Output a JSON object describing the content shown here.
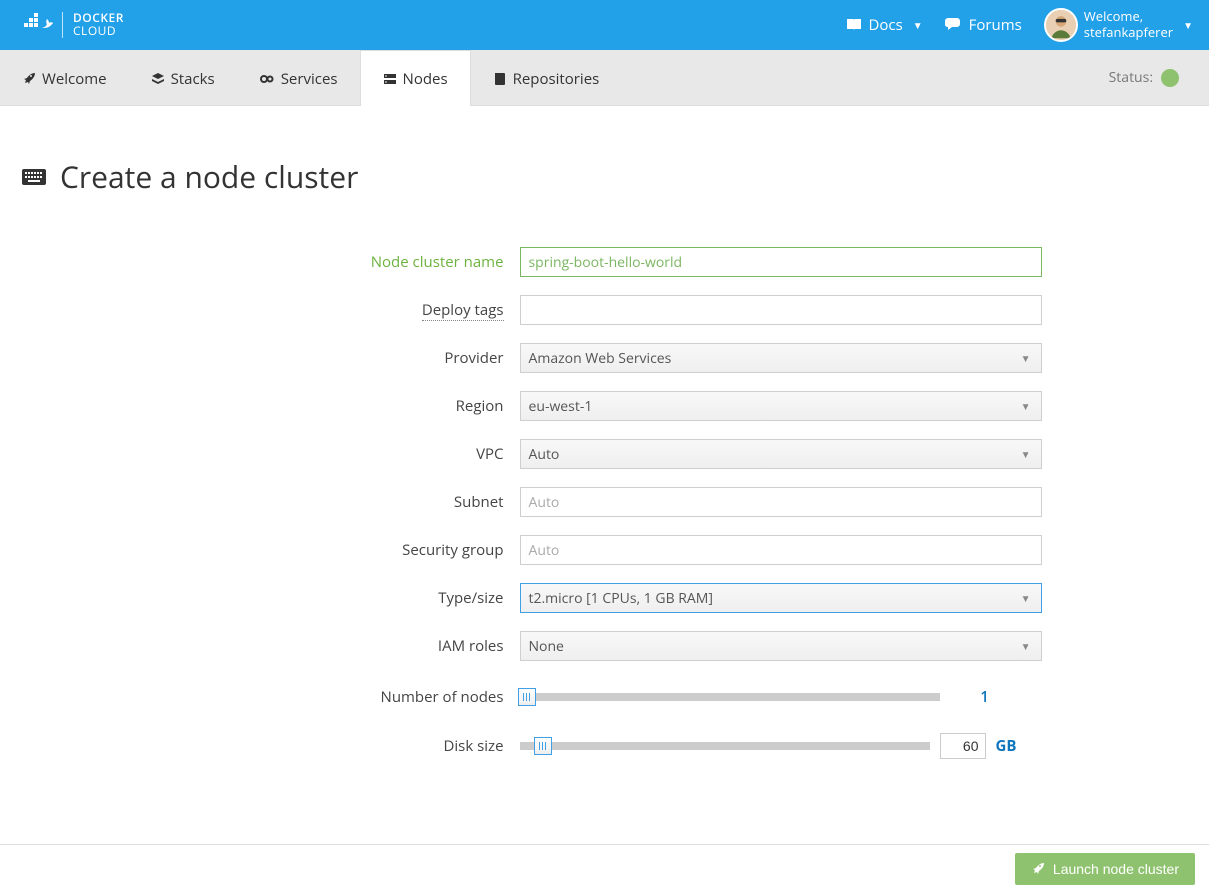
{
  "header": {
    "brand_line1": "DOCKER",
    "brand_line2": "CLOUD",
    "docs_label": "Docs",
    "forums_label": "Forums",
    "welcome_label": "Welcome,",
    "username": "stefankapferer"
  },
  "tabs": {
    "welcome": "Welcome",
    "stacks": "Stacks",
    "services": "Services",
    "nodes": "Nodes",
    "repositories": "Repositories",
    "status_label": "Status:"
  },
  "page": {
    "title": "Create a node cluster"
  },
  "form": {
    "name_label": "Node cluster name",
    "name_value": "spring-boot-hello-world",
    "tags_label": "Deploy tags",
    "tags_value": "",
    "provider_label": "Provider",
    "provider_value": "Amazon Web Services",
    "region_label": "Region",
    "region_value": "eu-west-1",
    "vpc_label": "VPC",
    "vpc_value": "Auto",
    "subnet_label": "Subnet",
    "subnet_placeholder": "Auto",
    "secgroup_label": "Security group",
    "secgroup_placeholder": "Auto",
    "type_label": "Type/size",
    "type_value": "t2.micro [1 CPUs, 1 GB RAM]",
    "iam_label": "IAM roles",
    "iam_value": "None",
    "nodes_label": "Number of nodes",
    "nodes_value": "1",
    "disk_label": "Disk size",
    "disk_value": "60",
    "disk_unit": "GB"
  },
  "footer": {
    "launch_label": "Launch node cluster"
  }
}
